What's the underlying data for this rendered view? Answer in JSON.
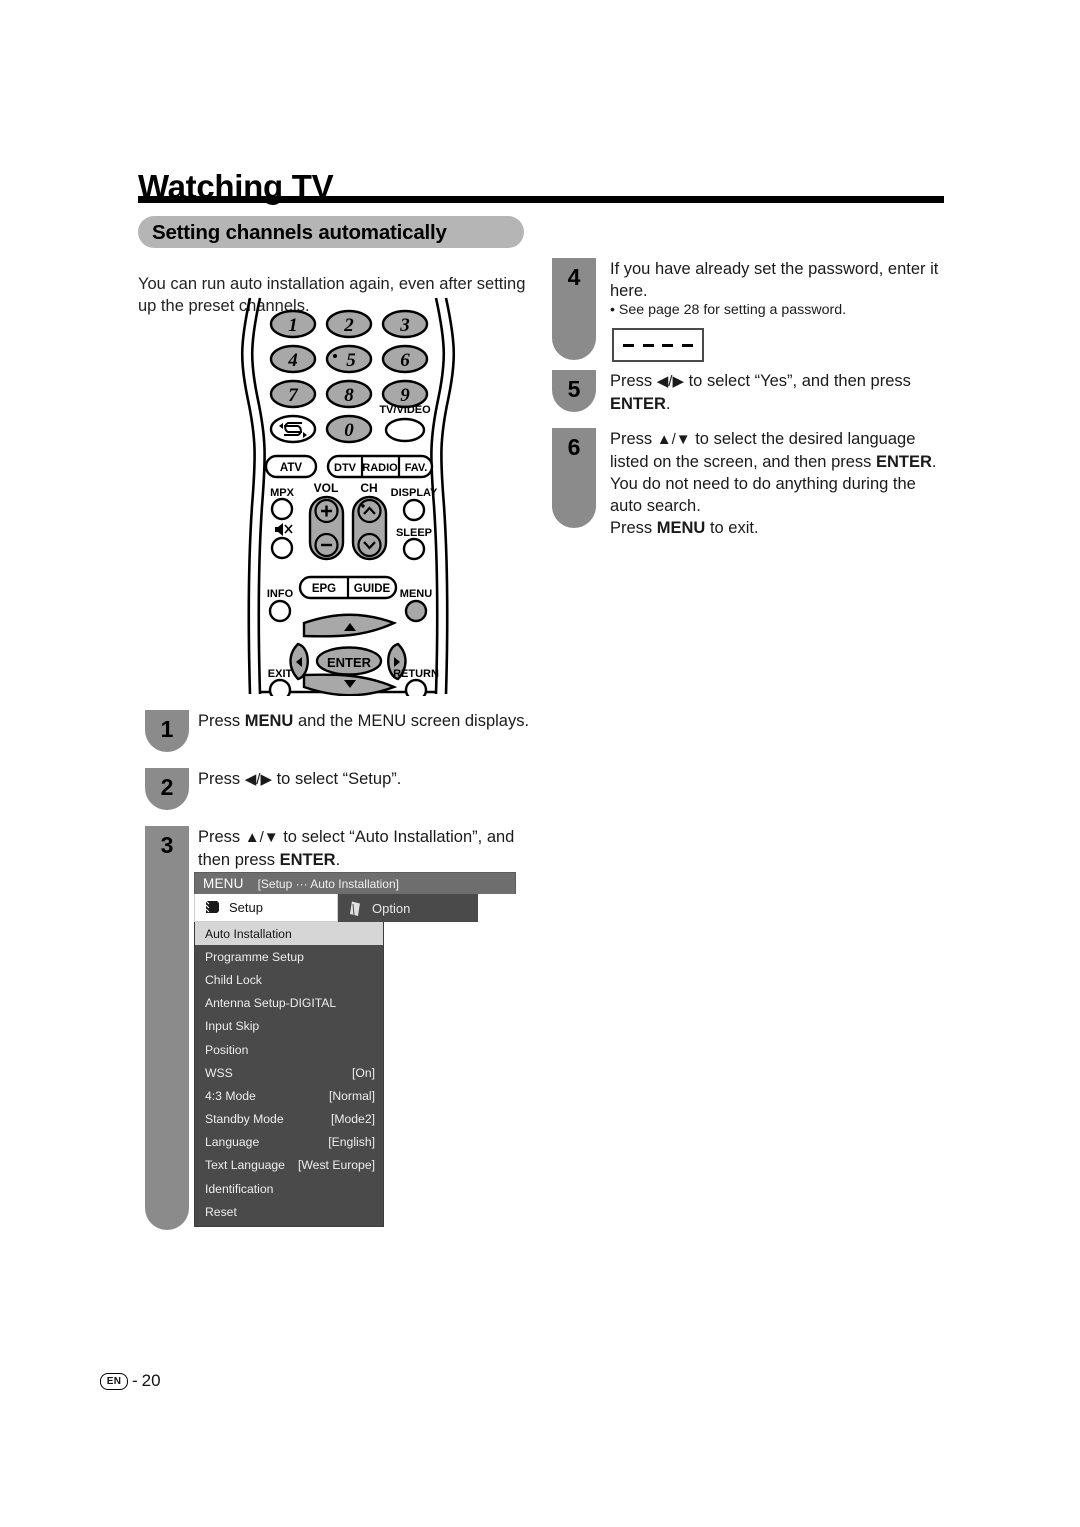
{
  "page": {
    "title": "Watching TV",
    "section_title": "Setting channels automatically",
    "intro": "You can run auto installation again, even after setting up the preset channels.",
    "footer_locale": "EN",
    "footer_separator": "-",
    "footer_page_number": "20",
    "accent_gray": "#8b8b8b",
    "pill_gray": "#b5b5b5",
    "menu_dark": "#4a4a4a",
    "menu_titlebar_gray": "#6e6e6e",
    "menu_highlight": "#d6d6d6"
  },
  "steps": [
    {
      "number": "1",
      "text_html": "Press <b>MENU</b> and the MENU screen displays."
    },
    {
      "number": "2",
      "text_html": "Press <span class=\"arrowglyph\">◀/▶</span> to select “Setup”."
    },
    {
      "number": "3",
      "text_html": "Press <span class=\"arrowglyph\">▲/▼</span> to select “Auto Installation”, and then press <b>ENTER</b>."
    },
    {
      "number": "4",
      "text_html": "If you have already set the password, enter it here.",
      "bullet": "• See page 28 for setting a password.",
      "password_placeholder": "– – – –"
    },
    {
      "number": "5",
      "text_html": "Press <span class=\"arrowglyph\">◀/▶</span> to select “Yes”, and then press <b>ENTER</b>."
    },
    {
      "number": "6",
      "text_html": "Press <span class=\"arrowglyph\">▲/▼</span> to select the desired language listed on the screen, and then press <b>ENTER</b>. You do not need to do anything during the auto search.<br>Press <b>MENU</b> to exit."
    }
  ],
  "remote": {
    "numeric_keys": [
      "1",
      "2",
      "3",
      "4",
      "5",
      "6",
      "7",
      "8",
      "9",
      "0"
    ],
    "flashback_key": "flashback",
    "tv_video_label": "TV/VIDEO",
    "source_buttons": [
      "ATV",
      "DTV",
      "RADIO",
      "FAV."
    ],
    "labels": {
      "mpx": "MPX",
      "vol": "VOL",
      "ch": "CH",
      "display": "DISPLAY",
      "sleep": "SLEEP",
      "info": "INFO",
      "epg": "EPG",
      "guide": "GUIDE",
      "menu": "MENU",
      "enter": "ENTER",
      "exit": "EXIT",
      "return": "RETURN",
      "vol_plus": "+",
      "vol_minus": "–"
    }
  },
  "tv_menu": {
    "titlebar_label": "MENU",
    "titlebar_path": "[Setup ··· Auto Installation]",
    "tabs": [
      {
        "label": "Setup",
        "active": true
      },
      {
        "label": "Option",
        "active": false
      }
    ],
    "items": [
      {
        "label": "Auto Installation",
        "value": "",
        "selected": true
      },
      {
        "label": "Programme Setup",
        "value": "",
        "selected": false
      },
      {
        "label": "Child Lock",
        "value": "",
        "selected": false
      },
      {
        "label": "Antenna Setup-DIGITAL",
        "value": "",
        "selected": false
      },
      {
        "label": "Input Skip",
        "value": "",
        "selected": false
      },
      {
        "label": "Position",
        "value": "",
        "selected": false
      },
      {
        "label": "WSS",
        "value": "[On]",
        "selected": false
      },
      {
        "label": "4:3 Mode",
        "value": "[Normal]",
        "selected": false
      },
      {
        "label": "Standby Mode",
        "value": "[Mode2]",
        "selected": false
      },
      {
        "label": "Language",
        "value": "[English]",
        "selected": false
      },
      {
        "label": "Text Language",
        "value": "[West Europe]",
        "selected": false
      },
      {
        "label": "Identification",
        "value": "",
        "selected": false
      },
      {
        "label": "Reset",
        "value": "",
        "selected": false
      }
    ]
  }
}
